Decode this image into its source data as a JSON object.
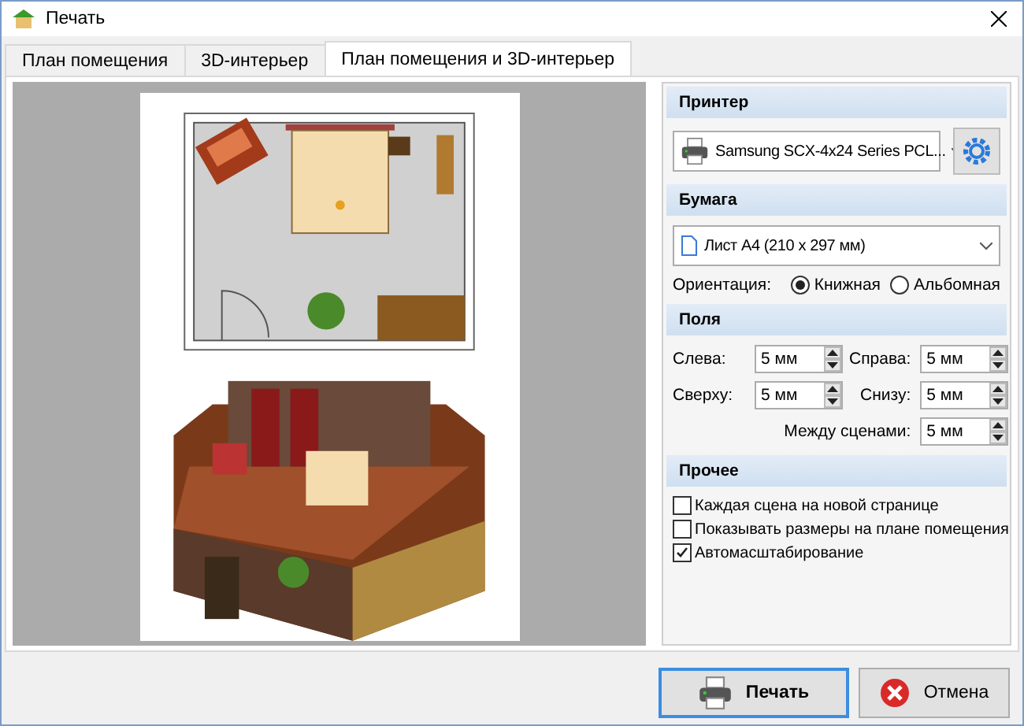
{
  "window": {
    "title": "Печать"
  },
  "tabs": [
    {
      "label": "План помещения",
      "selected": false
    },
    {
      "label": "3D-интерьер",
      "selected": false
    },
    {
      "label": "План помещения и 3D-интерьер",
      "selected": true
    }
  ],
  "printer": {
    "section": "Принтер",
    "device": "Samsung SCX-4x24 Series PCL..."
  },
  "paper": {
    "section": "Бумага",
    "size": "Лист A4 (210 x 297 мм)",
    "orientation_label": "Ориентация:",
    "orientations": [
      {
        "label": "Книжная",
        "selected": true
      },
      {
        "label": "Альбомная",
        "selected": false
      }
    ]
  },
  "margins": {
    "section": "Поля",
    "fields": [
      {
        "label": "Слева:",
        "value": "5 мм"
      },
      {
        "label": "Справа:",
        "value": "5 мм"
      },
      {
        "label": "Сверху:",
        "value": "5 мм"
      },
      {
        "label": "Снизу:",
        "value": "5 мм"
      },
      {
        "label": "Между сценами:",
        "value": "5 мм"
      }
    ]
  },
  "other": {
    "section": "Прочее",
    "options": [
      {
        "label": "Каждая сцена на новой странице",
        "checked": false
      },
      {
        "label": "Показывать размеры на плане помещения",
        "checked": false
      },
      {
        "label": "Автомасштабирование",
        "checked": true
      }
    ]
  },
  "buttons": [
    {
      "label": "Печать",
      "kind": "print"
    },
    {
      "label": "Отмена",
      "kind": "cancel"
    }
  ]
}
